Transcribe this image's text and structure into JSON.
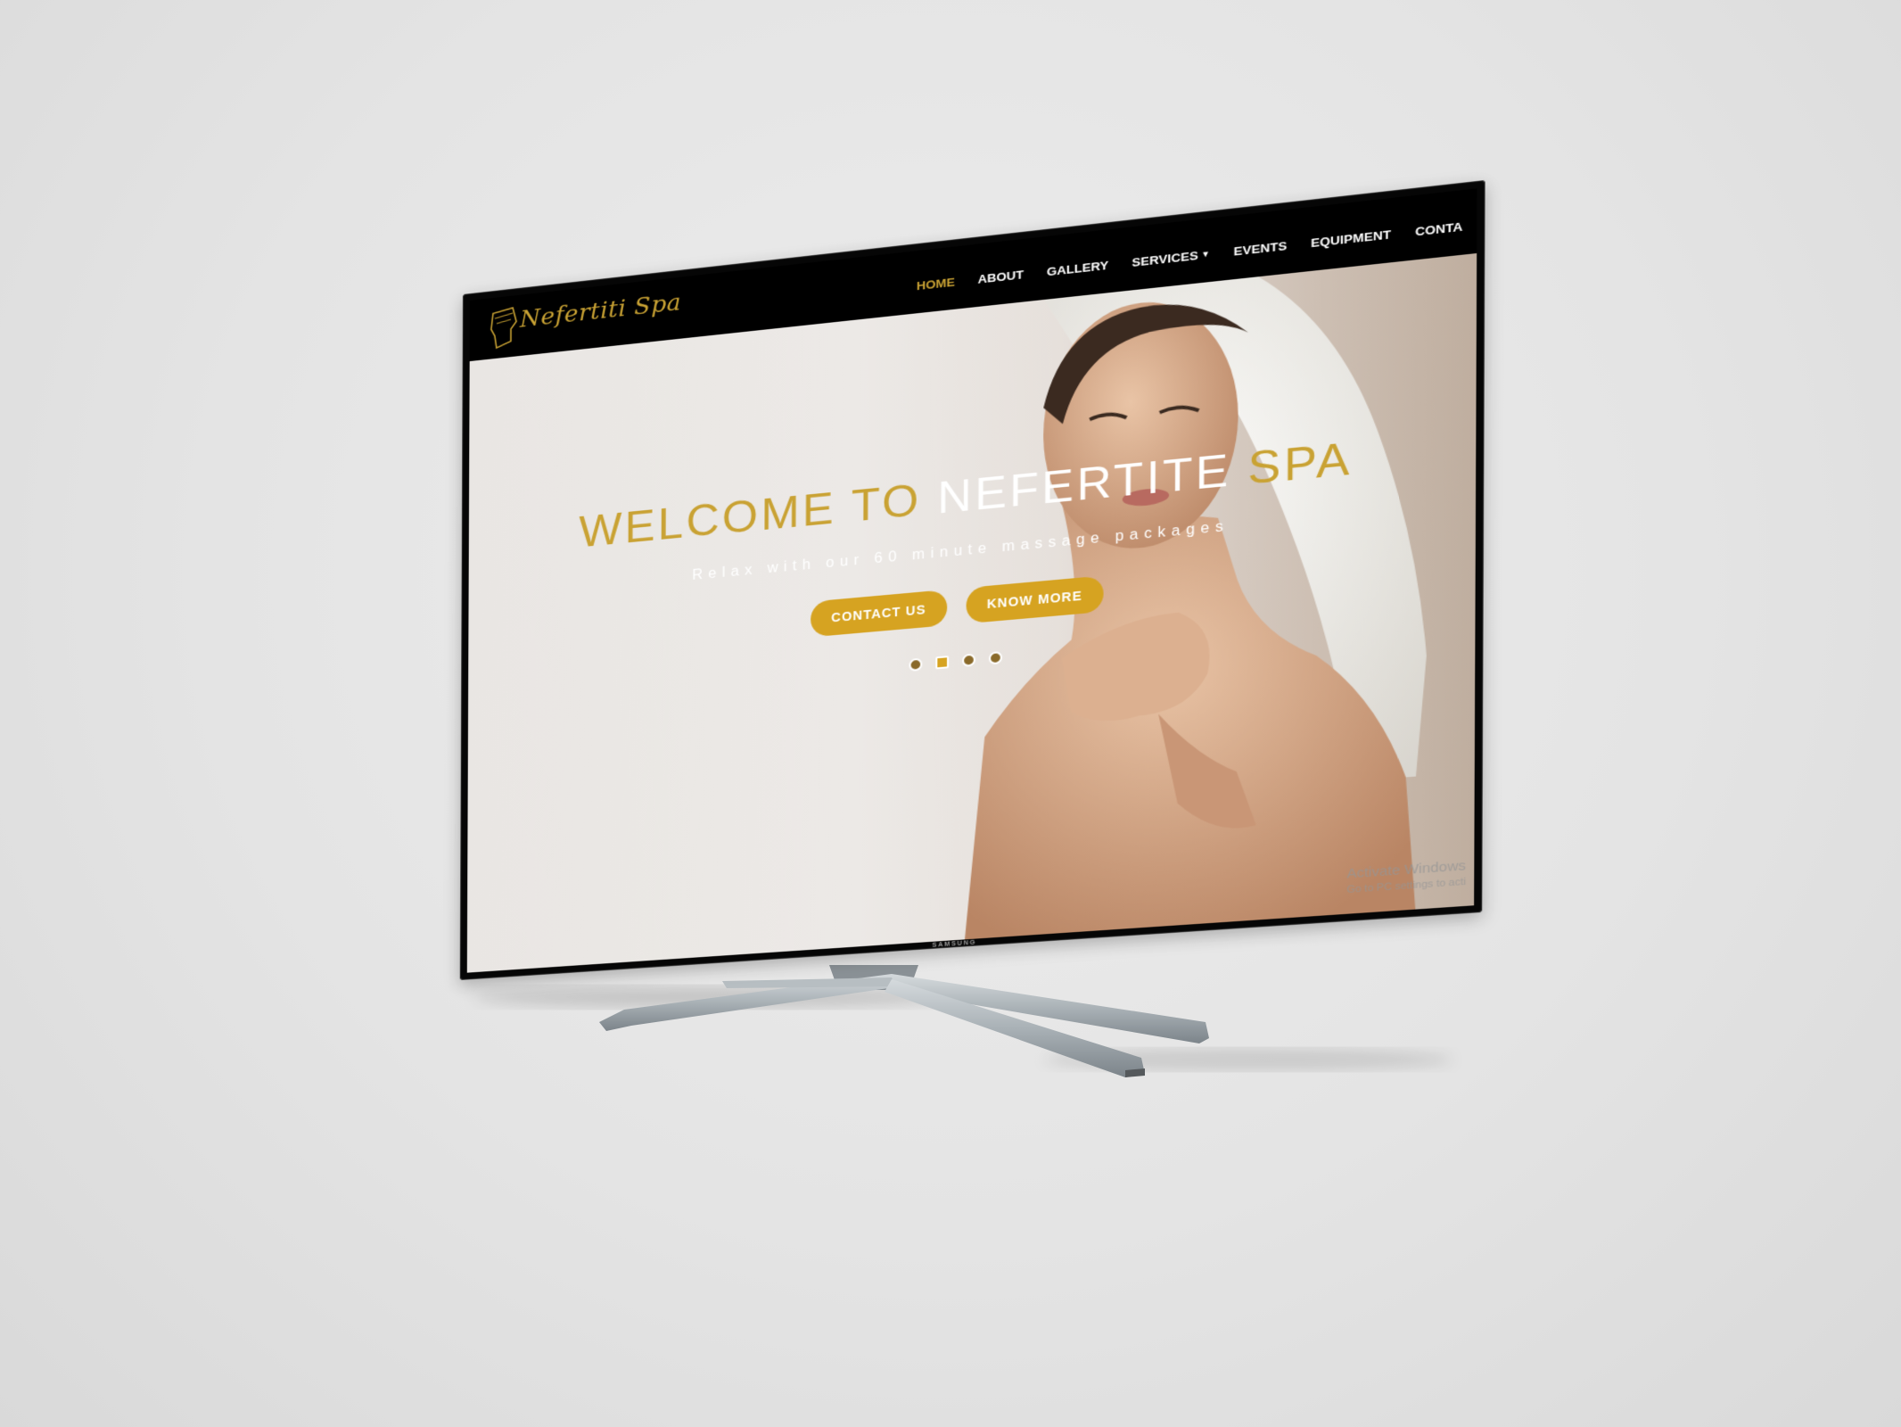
{
  "device": {
    "brand": "SAMSUNG"
  },
  "site": {
    "logo_text": "Nefertiti Spa",
    "nav": [
      {
        "label": "HOME",
        "active": true
      },
      {
        "label": "ABOUT"
      },
      {
        "label": "GALLERY"
      },
      {
        "label": "SERVICES",
        "dropdown": true
      },
      {
        "label": "EVENTS"
      },
      {
        "label": "EQUIPMENT"
      },
      {
        "label": "CONTA"
      }
    ]
  },
  "hero": {
    "title_part1": "WELCOME TO ",
    "title_part2": "NEFERTITE",
    "title_part3": " SPA",
    "subtitle": "Relax with our 60 minute massage packages",
    "button_contact": "CONTACT US",
    "button_know_more": "KNOW MORE",
    "slides_total": 4,
    "slide_active": 2
  },
  "watermark": {
    "line1": "Activate Windows",
    "line2": "Go to PC settings to acti"
  },
  "colors": {
    "gold": "#c9a233",
    "button_gold": "#d6a321",
    "header_bg": "#000000",
    "background": "#e6e6e6"
  }
}
